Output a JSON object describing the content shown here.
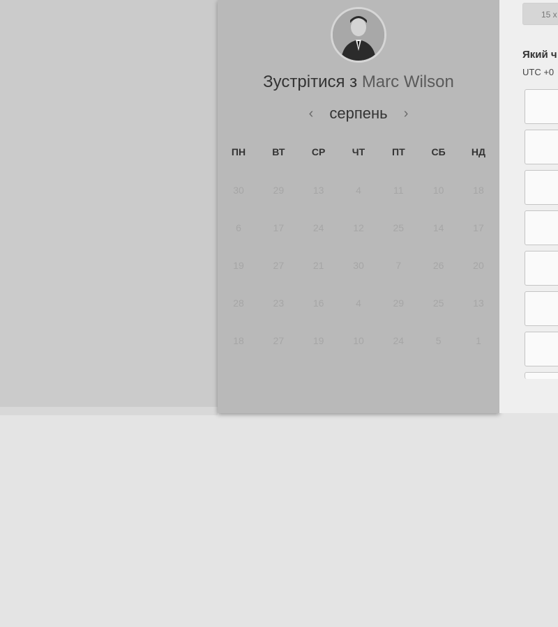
{
  "header": {
    "title_prefix": "Зустрітися з",
    "host_name": "Marc Wilson"
  },
  "calendar": {
    "month": "серпень",
    "prev_icon": "‹",
    "next_icon": "›",
    "weekdays": [
      "ПН",
      "ВТ",
      "СР",
      "ЧТ",
      "ПТ",
      "СБ",
      "НД"
    ],
    "weeks": [
      [
        "30",
        "29",
        "13",
        "4",
        "11",
        "10",
        "18"
      ],
      [
        "6",
        "17",
        "24",
        "12",
        "25",
        "14",
        "17"
      ],
      [
        "19",
        "27",
        "21",
        "30",
        "7",
        "26",
        "20"
      ],
      [
        "28",
        "23",
        "16",
        "4",
        "29",
        "25",
        "13"
      ],
      [
        "18",
        "27",
        "19",
        "10",
        "24",
        "5",
        "1"
      ]
    ]
  },
  "scheduler": {
    "duration_value": "15 x",
    "time_question": "Який ч",
    "timezone": "UTC +0"
  },
  "icons": {
    "avatar": "user-avatar-photo",
    "prev": "chevron-left-icon",
    "next": "chevron-right-icon"
  },
  "colors": {
    "card_background": "#b9b9b9",
    "page_background": "#e4e4e4",
    "left_pane": "#cbcbcb",
    "right_pane": "#efefef"
  }
}
